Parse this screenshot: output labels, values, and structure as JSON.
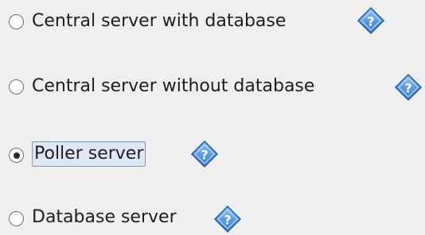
{
  "options": [
    {
      "label": "Central server with database",
      "selected": false,
      "help_icon": "help-diamond-icon"
    },
    {
      "label": "Central server without database",
      "selected": false,
      "help_icon": "help-diamond-icon"
    },
    {
      "label": "Poller server",
      "selected": true,
      "help_icon": "help-diamond-icon"
    },
    {
      "label": "Database server",
      "selected": false,
      "help_icon": "help-diamond-icon"
    }
  ],
  "colors": {
    "background": "#efefef",
    "help_icon_fill": "#4a8fd8",
    "help_icon_border": "#1f5fa8",
    "selection_highlight": "#dde7f3"
  }
}
